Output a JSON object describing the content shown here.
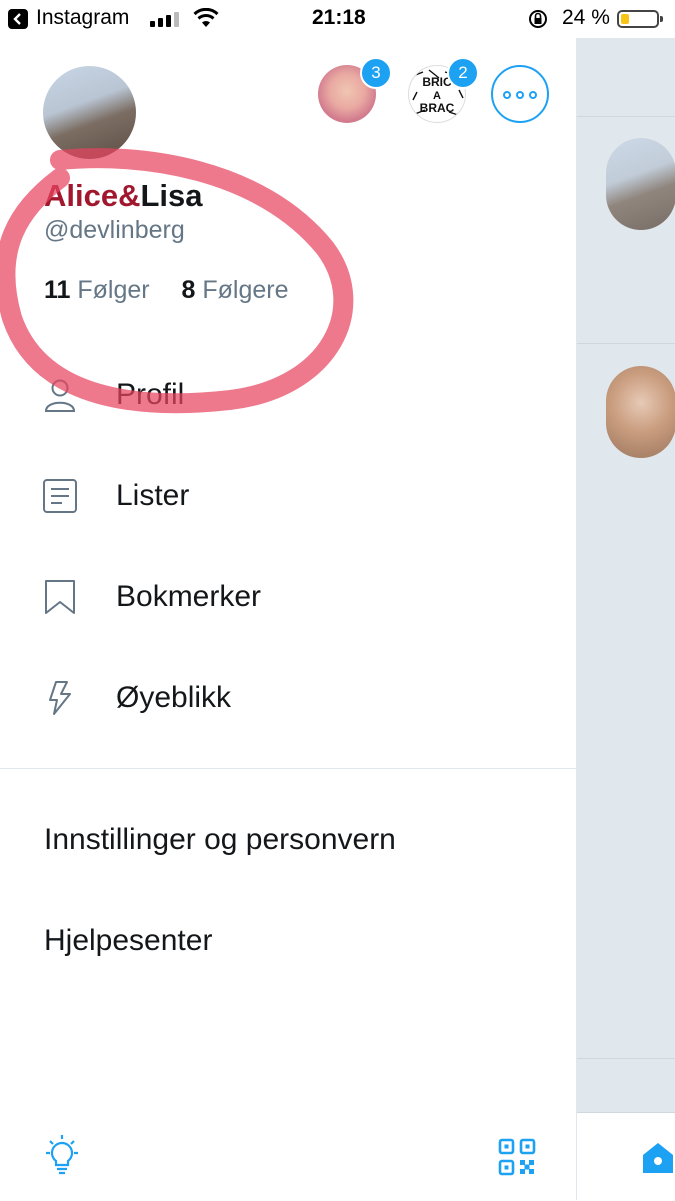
{
  "status_bar": {
    "back_app": "Instagram",
    "time": "21:18",
    "battery_pct": "24 %",
    "battery_level": 0.24
  },
  "account": {
    "name_red": "Alice&",
    "name_dark": "Lisa",
    "handle": "@devlinberg",
    "following_count": "11",
    "following_label": "Følger",
    "followers_count": "8",
    "followers_label": "Følgere"
  },
  "other_accounts": [
    {
      "badge": "3"
    },
    {
      "badge": "2",
      "logo_text": "BRIC A BRAC"
    }
  ],
  "menu": [
    {
      "label": "Profil",
      "icon": "person-icon"
    },
    {
      "label": "Lister",
      "icon": "list-icon"
    },
    {
      "label": "Bokmerker",
      "icon": "bookmark-icon"
    },
    {
      "label": "Øyeblikk",
      "icon": "lightning-icon"
    }
  ],
  "settings": {
    "settings_label": "Innstillinger og personvern",
    "help_label": "Hjelpesenter"
  },
  "colors": {
    "accent": "#1da1f2",
    "text": "#14171a",
    "secondary": "#657786",
    "annotation": "#e8445f"
  }
}
